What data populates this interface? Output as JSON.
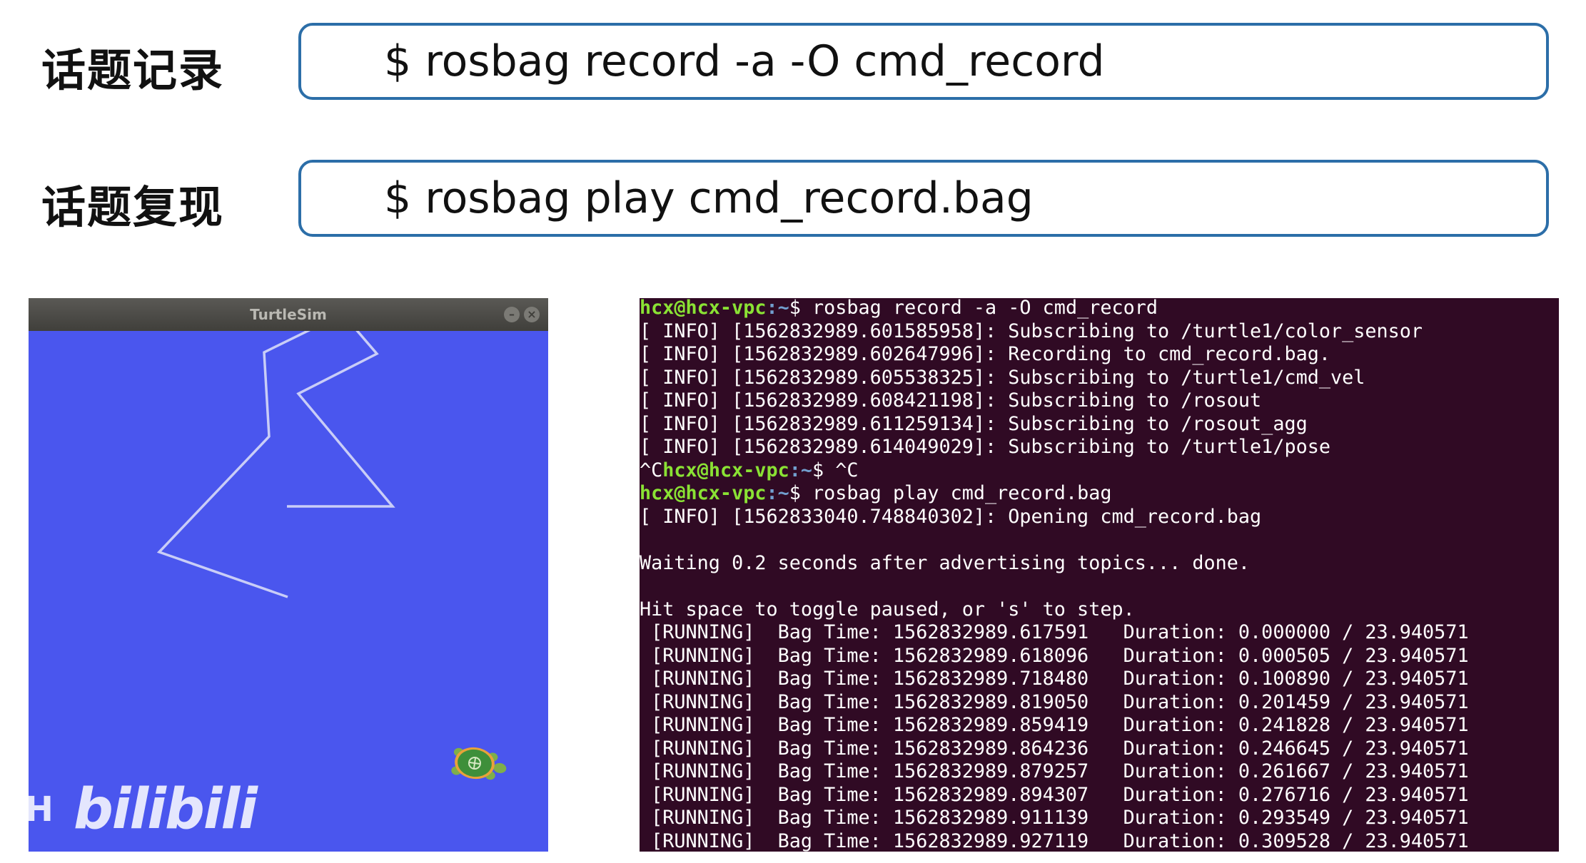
{
  "rows": [
    {
      "label": "话题记录",
      "command": "$ rosbag record -a -O cmd_record"
    },
    {
      "label": "话题复现",
      "command": "$ rosbag play cmd_record.bag"
    }
  ],
  "turtlesim": {
    "title": "TurtleSim",
    "minimize_glyph": "–",
    "close_glyph": "×",
    "background": "#4a56ee",
    "turtle_icon": "turtle-icon"
  },
  "watermark": {
    "user": "YH",
    "logo": "bilibili"
  },
  "terminal": {
    "background": "#300a24",
    "prompt_user_color": "#8ae234",
    "prompt_path_color": "#729fcf",
    "lines": [
      {
        "type": "prompt",
        "pre": "",
        "user": "hcx@hcx-vpc",
        "path": ":~",
        "cmd": "$ rosbag record -a -O cmd_record"
      },
      {
        "type": "text",
        "text": "[ INFO] [1562832989.601585958]: Subscribing to /turtle1/color_sensor"
      },
      {
        "type": "text",
        "text": "[ INFO] [1562832989.602647996]: Recording to cmd_record.bag."
      },
      {
        "type": "text",
        "text": "[ INFO] [1562832989.605538325]: Subscribing to /turtle1/cmd_vel"
      },
      {
        "type": "text",
        "text": "[ INFO] [1562832989.608421198]: Subscribing to /rosout"
      },
      {
        "type": "text",
        "text": "[ INFO] [1562832989.611259134]: Subscribing to /rosout_agg"
      },
      {
        "type": "text",
        "text": "[ INFO] [1562832989.614049029]: Subscribing to /turtle1/pose"
      },
      {
        "type": "prompt",
        "pre": "^C",
        "user": "hcx@hcx-vpc",
        "path": ":~",
        "cmd": "$ ^C"
      },
      {
        "type": "prompt",
        "pre": "",
        "user": "hcx@hcx-vpc",
        "path": ":~",
        "cmd": "$ rosbag play cmd_record.bag"
      },
      {
        "type": "text",
        "text": "[ INFO] [1562833040.748840302]: Opening cmd_record.bag"
      },
      {
        "type": "text",
        "text": ""
      },
      {
        "type": "text",
        "text": "Waiting 0.2 seconds after advertising topics... done."
      },
      {
        "type": "text",
        "text": ""
      },
      {
        "type": "text",
        "text": "Hit space to toggle paused, or 's' to step."
      },
      {
        "type": "text",
        "text": " [RUNNING]  Bag Time: 1562832989.617591   Duration: 0.000000 / 23.940571"
      },
      {
        "type": "text",
        "text": " [RUNNING]  Bag Time: 1562832989.618096   Duration: 0.000505 / 23.940571"
      },
      {
        "type": "text",
        "text": " [RUNNING]  Bag Time: 1562832989.718480   Duration: 0.100890 / 23.940571"
      },
      {
        "type": "text",
        "text": " [RUNNING]  Bag Time: 1562832989.819050   Duration: 0.201459 / 23.940571"
      },
      {
        "type": "text",
        "text": " [RUNNING]  Bag Time: 1562832989.859419   Duration: 0.241828 / 23.940571"
      },
      {
        "type": "text",
        "text": " [RUNNING]  Bag Time: 1562832989.864236   Duration: 0.246645 / 23.940571"
      },
      {
        "type": "text",
        "text": " [RUNNING]  Bag Time: 1562832989.879257   Duration: 0.261667 / 23.940571"
      },
      {
        "type": "text",
        "text": " [RUNNING]  Bag Time: 1562832989.894307   Duration: 0.276716 / 23.940571"
      },
      {
        "type": "text",
        "text": " [RUNNING]  Bag Time: 1562832989.911139   Duration: 0.293549 / 23.940571"
      },
      {
        "type": "text",
        "text": " [RUNNING]  Bag Time: 1562832989.927119   Duration: 0.309528 / 23.940571"
      }
    ]
  }
}
